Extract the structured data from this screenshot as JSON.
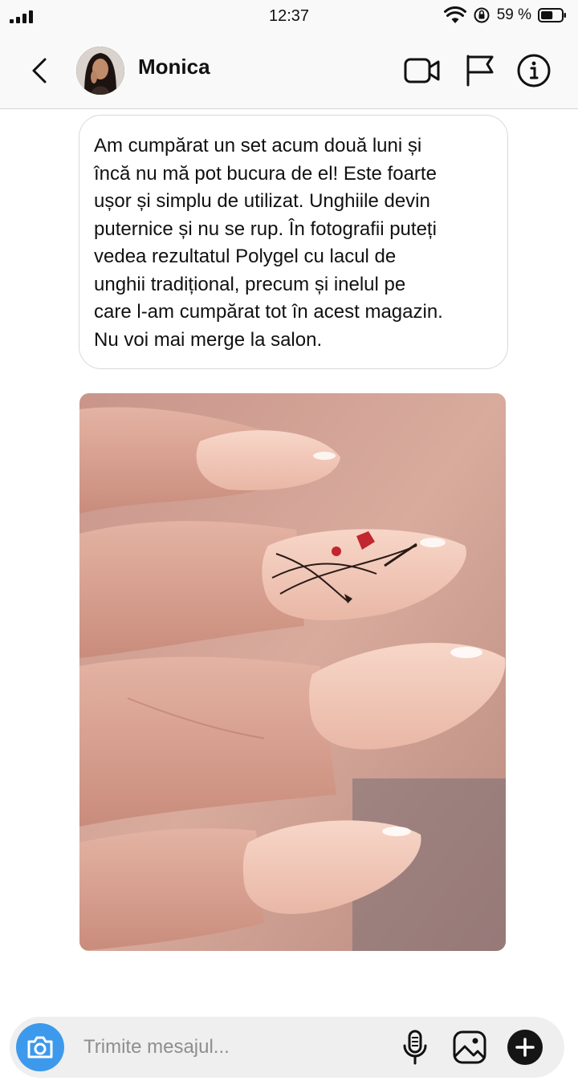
{
  "status_bar": {
    "time": "12:37",
    "battery_percent": "59 %",
    "battery_level": 0.59,
    "icons": [
      "signal-icon",
      "wifi-icon",
      "orientation-lock-icon",
      "battery-icon"
    ]
  },
  "header": {
    "contact_name": "Monica",
    "icons": [
      "back-arrow-icon",
      "video-call-icon",
      "flag-icon",
      "info-icon"
    ]
  },
  "message": {
    "lines": [
      "Am cumpărat un set acum două luni și",
      "încă nu mă pot bucura de el! Este foarte",
      "ușor și simplu de utilizat. Unghiile devin",
      "puternice și nu se rup. În fotografii puteți",
      "vedea rezultatul Polygel cu lacul de",
      "unghii tradițional, precum și inelul pe",
      "care l-am cumpărat tot în acest magazin.",
      "Nu voi mai merge la salon."
    ]
  },
  "composer": {
    "placeholder": "Trimite mesajul...",
    "icons": [
      "camera-icon",
      "microphone-icon",
      "gallery-icon",
      "plus-icon"
    ]
  },
  "colors": {
    "camera_button": "#3d99ec",
    "plus_button": "#151515",
    "header_bg": "#f9f9f9",
    "composer_bg": "#efefef"
  }
}
